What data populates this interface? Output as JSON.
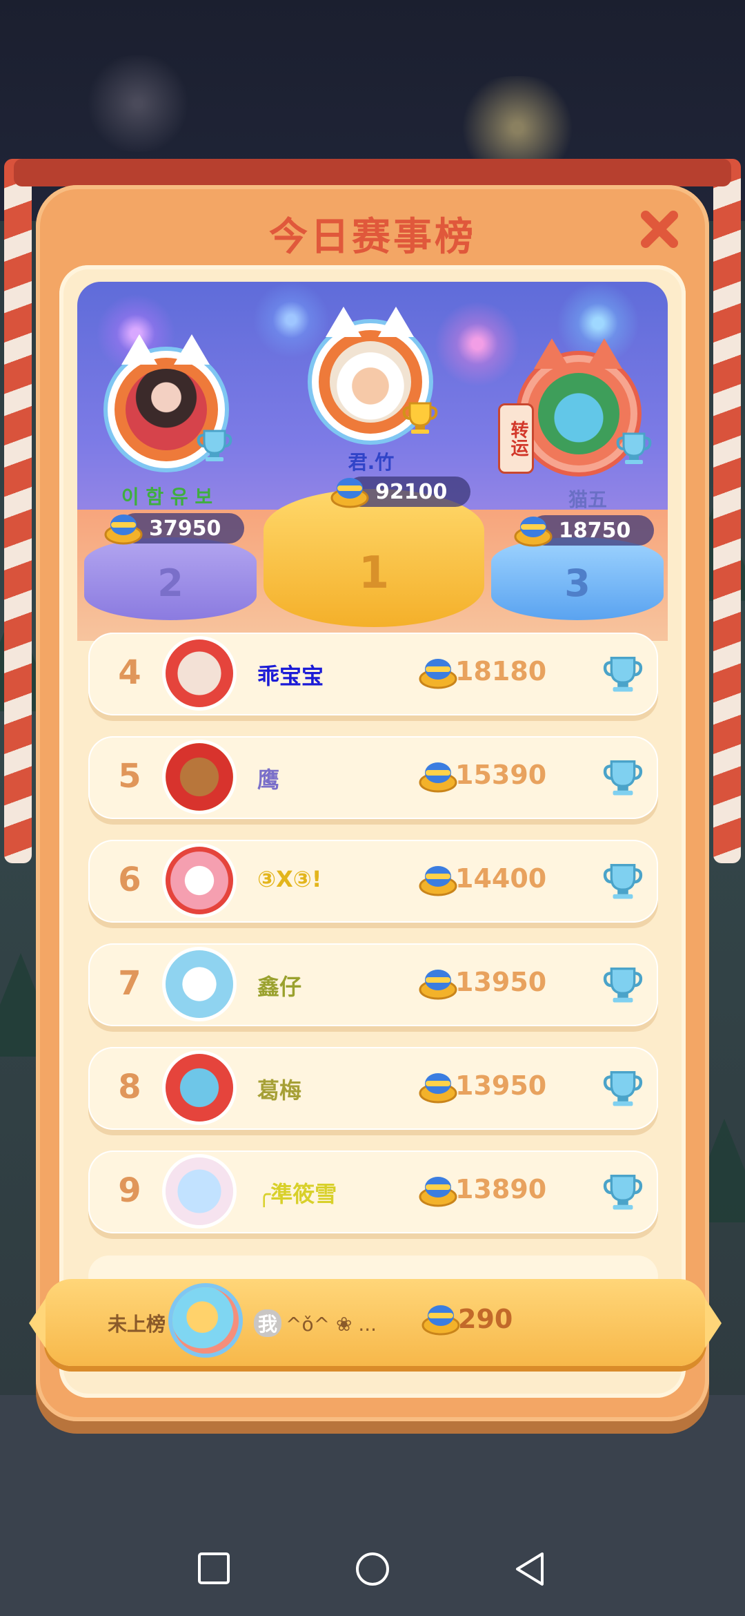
{
  "title": "今日赛事榜",
  "podium": [
    {
      "rank": "2",
      "name": "이 함 유 보",
      "score": "37950"
    },
    {
      "rank": "1",
      "name": "君.竹",
      "score": "92100"
    },
    {
      "rank": "3",
      "name": "猫五",
      "score": "18750"
    }
  ],
  "frame_badge": "转运",
  "rows": [
    {
      "rank": "4",
      "name": "乖宝宝",
      "score": "18180",
      "name_color": "#1b1bd6"
    },
    {
      "rank": "5",
      "name": "鹰",
      "score": "15390",
      "name_color": "#7a6fc9"
    },
    {
      "rank": "6",
      "name": "③X③!",
      "score": "14400",
      "name_color": "#e3b51c"
    },
    {
      "rank": "7",
      "name": "鑫仔",
      "score": "13950",
      "name_color": "#9aa12e"
    },
    {
      "rank": "8",
      "name": "葛梅",
      "score": "13950",
      "name_color": "#a6a036"
    },
    {
      "rank": "9",
      "name": "╭準筱雪",
      "score": "13890",
      "name_color": "#d8d02a"
    }
  ],
  "my": {
    "status": "未上榜",
    "tag": "我",
    "name": "^ǒ^ ❀ ...",
    "score": "290"
  },
  "colors": {
    "accent": "#e0583b",
    "panel": "#f3a665",
    "row_score": "#e8a25e"
  },
  "icons": [
    "close-icon",
    "coin-icon",
    "trophy-icon",
    "square-nav-icon",
    "circle-nav-icon",
    "triangle-back-icon"
  ]
}
